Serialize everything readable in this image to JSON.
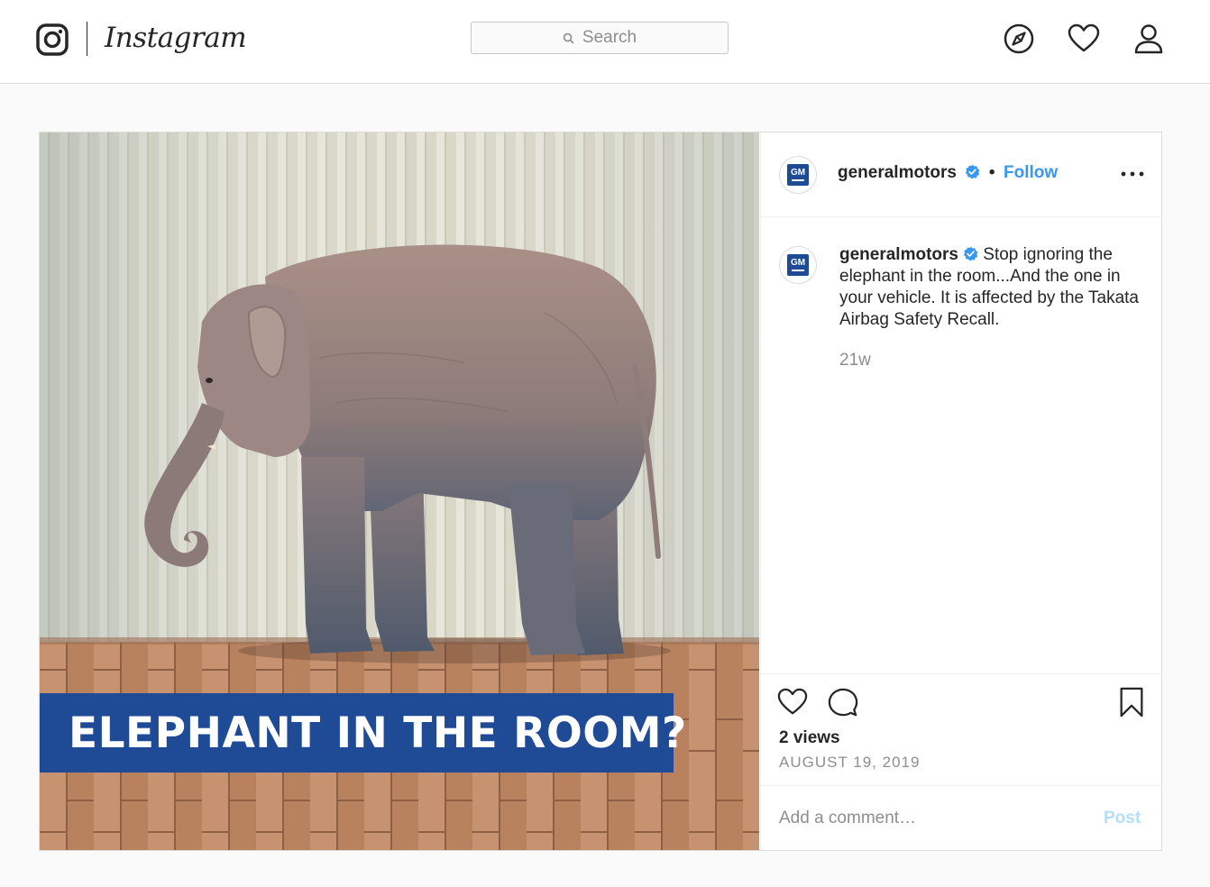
{
  "app": {
    "brand": "Instagram",
    "colors": {
      "accent": "#3897f0",
      "post_disabled": "#b2dffc",
      "banner": "#1f4a95",
      "border": "#dbdbdb"
    }
  },
  "nav": {
    "search_placeholder": "Search",
    "icons": [
      "instagram-camera-icon",
      "compass-icon",
      "heart-icon",
      "profile-icon"
    ]
  },
  "post": {
    "media": {
      "banner_text": "ELEPHANT IN THE ROOM?",
      "avatar_text": "GM"
    },
    "header": {
      "username": "generalmotors",
      "separator": "•",
      "follow_label": "Follow"
    },
    "caption": {
      "username": "generalmotors",
      "text": "Stop ignoring the elephant in the room...And the one in your vehicle. It is affected by the Takata Airbag Safety Recall.",
      "time_ago": "21w"
    },
    "stats": {
      "views": "2 views",
      "date": "AUGUST 19, 2019"
    },
    "comment": {
      "placeholder": "Add a comment…",
      "post_label": "Post"
    }
  }
}
